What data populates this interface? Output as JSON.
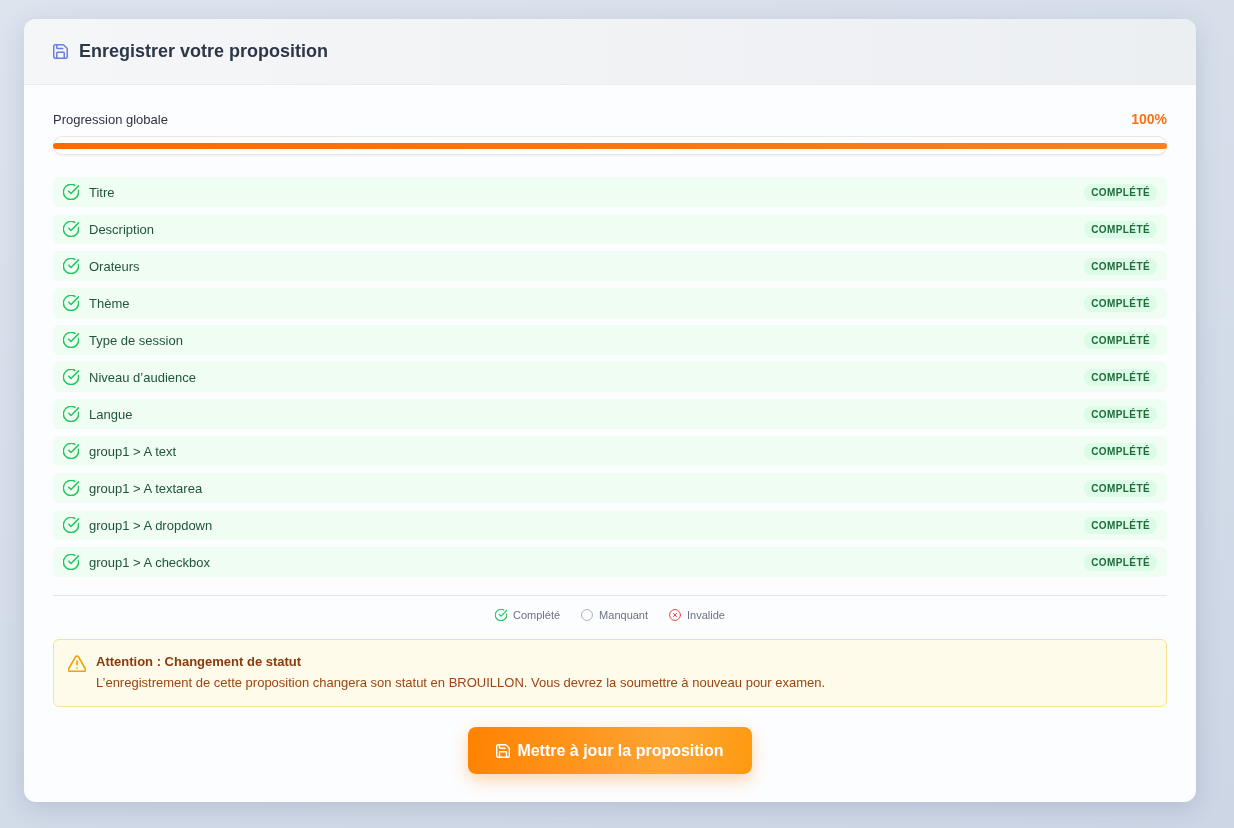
{
  "header": {
    "title": "Enregistrer votre proposition"
  },
  "progress": {
    "label": "Progression globale",
    "reading": "100%",
    "level": 1
  },
  "fields": [
    {
      "label": "Titre",
      "kind": "complete",
      "badge": "COMPLÉTÉ"
    },
    {
      "label": "Description",
      "kind": "complete",
      "badge": "COMPLÉTÉ"
    },
    {
      "label": "Orateurs",
      "kind": "complete",
      "badge": "COMPLÉTÉ"
    },
    {
      "label": "Thème",
      "kind": "complete",
      "badge": "COMPLÉTÉ"
    },
    {
      "label": "Type de session",
      "kind": "complete",
      "badge": "COMPLÉTÉ"
    },
    {
      "label": "Niveau d’audience",
      "kind": "complete",
      "badge": "COMPLÉTÉ"
    },
    {
      "label": "Langue",
      "kind": "complete",
      "badge": "COMPLÉTÉ"
    },
    {
      "label": "group1 > A text",
      "kind": "complete",
      "badge": "COMPLÉTÉ"
    },
    {
      "label": "group1 > A textarea",
      "kind": "complete",
      "badge": "COMPLÉTÉ"
    },
    {
      "label": "group1 > A dropdown",
      "kind": "complete",
      "badge": "COMPLÉTÉ"
    },
    {
      "label": "group1 > A checkbox",
      "kind": "complete",
      "badge": "COMPLÉTÉ"
    }
  ],
  "legend": [
    {
      "kind": "complete",
      "label": "Complété"
    },
    {
      "kind": "missing",
      "label": "Manquant"
    },
    {
      "kind": "invalid",
      "label": "Invalide"
    }
  ],
  "warning": {
    "title": "Attention : Changement de statut",
    "message": "L’enregistrement de cette proposition changera son statut en BROUILLON. Vous devrez la soumettre à nouveau pour examen."
  },
  "submit_button": {
    "label": "Mettre à jour la proposition"
  }
}
